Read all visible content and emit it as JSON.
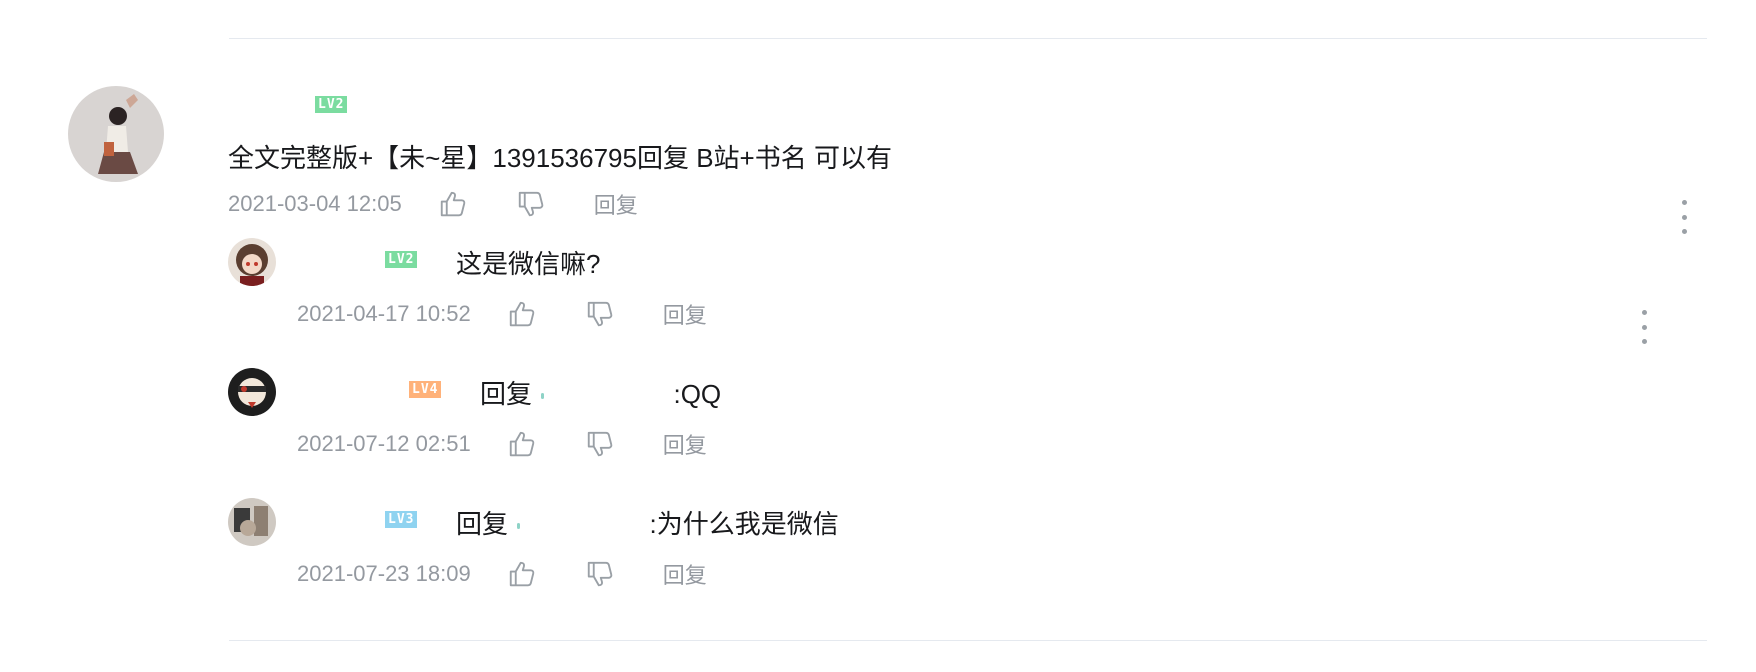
{
  "colors": {
    "lv2": "#7bdca0",
    "lv3": "#8fd3f0",
    "lv4": "#ffb27a",
    "meta": "#9499a0",
    "text": "#18191c"
  },
  "main_comment": {
    "level": "LV2",
    "content": "全文完整版+【未~星】1391536795回复 B站+书名 可以有",
    "time": "2021-03-04 12:05",
    "reply_label": "回复"
  },
  "replies": [
    {
      "level": "LV2",
      "content": "这是微信嘛?",
      "time": "2021-04-17 10:52",
      "reply_label": "回复"
    },
    {
      "level": "LV4",
      "prefix": "回复",
      "content": ":QQ",
      "time": "2021-07-12 02:51",
      "reply_label": "回复"
    },
    {
      "level": "LV3",
      "prefix": "回复",
      "content": ":为什么我是微信",
      "time": "2021-07-23 18:09",
      "reply_label": "回复"
    }
  ],
  "icons": {
    "like": "thumb-up-icon",
    "dislike": "thumb-down-icon",
    "more": "more-vertical-icon"
  }
}
